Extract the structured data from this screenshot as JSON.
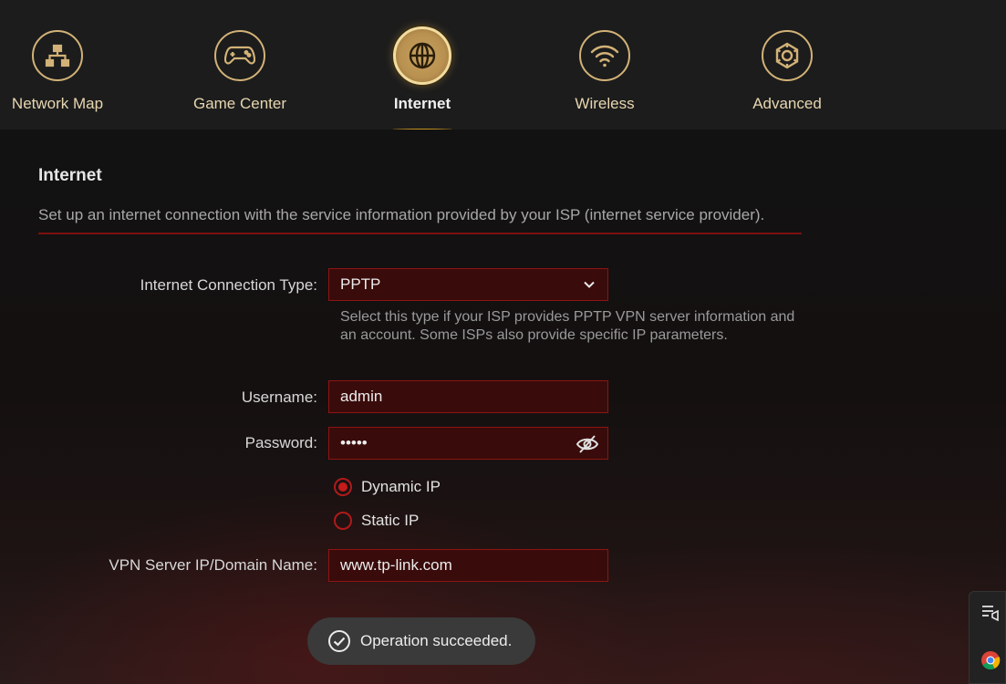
{
  "nav": {
    "items": [
      {
        "label": "Network Map",
        "icon": "network-map-icon"
      },
      {
        "label": "Game Center",
        "icon": "gamepad-icon"
      },
      {
        "label": "Internet",
        "icon": "globe-icon",
        "active": true
      },
      {
        "label": "Wireless",
        "icon": "wifi-icon"
      },
      {
        "label": "Advanced",
        "icon": "gear-icon"
      }
    ]
  },
  "section": {
    "title": "Internet",
    "description": "Set up an internet connection with the service information provided by your ISP (internet service provider)."
  },
  "form": {
    "connection_type_label": "Internet Connection Type:",
    "connection_type_value": "PPTP",
    "connection_type_hint": "Select this type if your ISP provides PPTP VPN server information and an account. Some ISPs also provide specific IP parameters.",
    "username_label": "Username:",
    "username_value": "admin",
    "password_label": "Password:",
    "password_value": "•••••",
    "ip_options": [
      {
        "label": "Dynamic IP",
        "checked": true
      },
      {
        "label": "Static IP",
        "checked": false
      }
    ],
    "vpn_server_label": "VPN Server IP/Domain Name:",
    "vpn_server_value": "www.tp-link.com"
  },
  "toast": {
    "message": "Operation succeeded."
  },
  "colors": {
    "accent_gold": "#d2b277",
    "accent_red": "#b01a1a",
    "field_bg": "#3a0b0b"
  }
}
